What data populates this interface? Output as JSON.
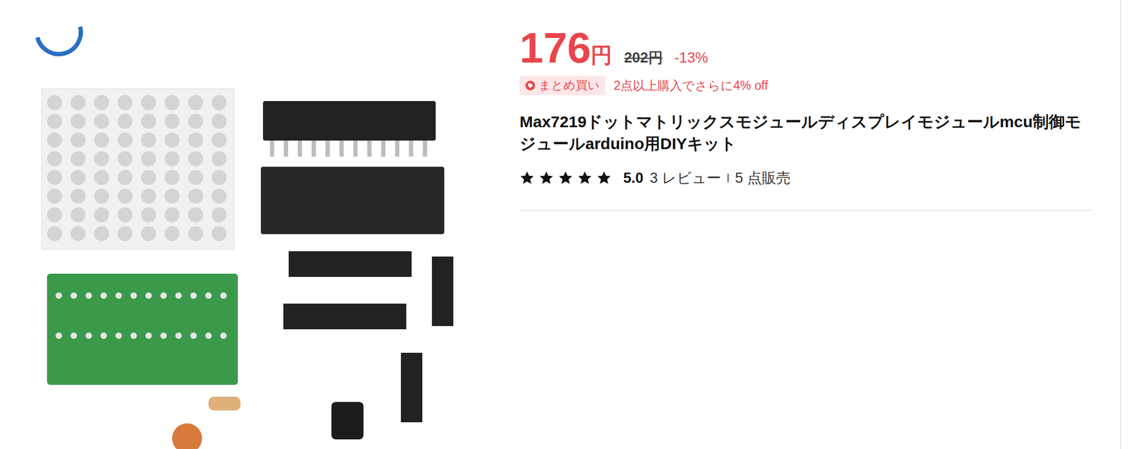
{
  "price": {
    "current": "176",
    "currency": "円",
    "original": "202円",
    "discount": "-13%"
  },
  "promo": {
    "badge": "まとめ買い",
    "text": "2点以上購入でさらに4% off"
  },
  "title": "Max7219ドットマトリックスモジュールディスプレイモジュールmcu制御モジュールarduino用DIYキット",
  "rating": {
    "stars": 5,
    "score": "5.0",
    "reviews": "3 レビュー",
    "sold": "5 点販売"
  }
}
